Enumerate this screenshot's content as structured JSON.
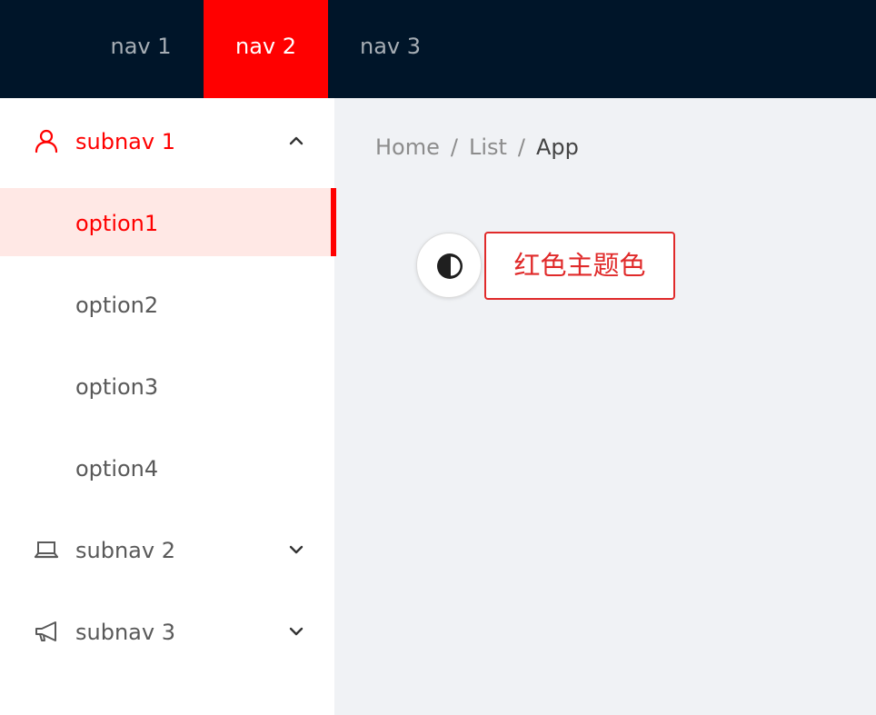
{
  "header": {
    "nav": [
      {
        "label": "nav 1",
        "active": false
      },
      {
        "label": "nav 2",
        "active": true
      },
      {
        "label": "nav 3",
        "active": false
      }
    ]
  },
  "sidebar": {
    "submenus": [
      {
        "label": "subnav 1",
        "icon": "user-icon",
        "open": true,
        "items": [
          "option1",
          "option2",
          "option3",
          "option4"
        ],
        "selected": "option1"
      },
      {
        "label": "subnav 2",
        "icon": "laptop-icon",
        "open": false
      },
      {
        "label": "subnav 3",
        "icon": "notification-icon",
        "open": false
      }
    ]
  },
  "breadcrumb": {
    "items": [
      "Home",
      "List",
      "App"
    ],
    "separator": "/"
  },
  "main": {
    "theme_toggle_icon": "half-moon-icon",
    "theme_button_label": "红色主题色"
  },
  "colors": {
    "header_bg": "#001529",
    "accent": "#ff0000",
    "selected_bg": "#ffe8e5",
    "content_bg": "#f0f2f5",
    "button_border": "#e02a2a"
  }
}
